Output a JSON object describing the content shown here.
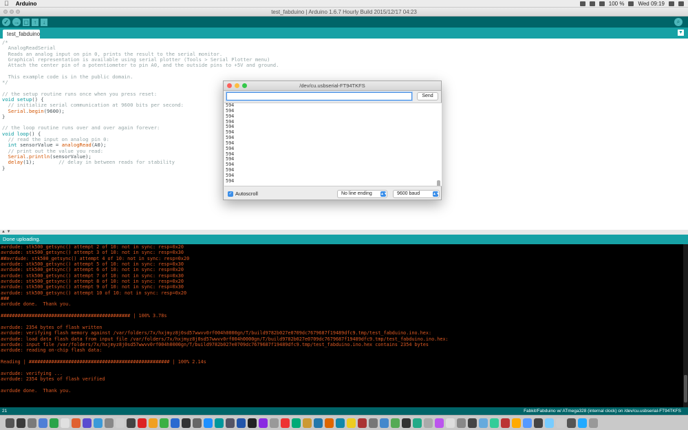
{
  "menubar": {
    "apple": "",
    "app_name": "Arduino",
    "battery": "100 %",
    "clock": "Wed 09:19"
  },
  "window": {
    "title": "test_fabduino | Arduino 1.6.7 Hourly Build 2015/12/17 04:23"
  },
  "toolbar": {
    "verify": "✓",
    "upload": "→",
    "new": "▢",
    "open": "↑",
    "save": "↓",
    "serial": "⌕"
  },
  "tab": {
    "name": "test_fabduino",
    "menu": "▼"
  },
  "code": [
    "/*",
    "  AnalogReadSerial",
    "  Reads an analog input on pin 0, prints the result to the serial monitor.",
    "  Graphical representation is available using serial plotter (Tools > Serial Plotter menu)",
    "  Attach the center pin of a potentiometer to pin A0, and the outside pins to +5V and ground.",
    "",
    "  This example code is in the public domain.",
    "*/",
    "",
    "// the setup routine runs once when you press reset:",
    "void setup() {",
    "  // initialize serial communication at 9600 bits per second:",
    "  Serial.begin(9600);",
    "}",
    "",
    "// the loop routine runs over and over again forever:",
    "void loop() {",
    "  // read the input on analog pin 0:",
    "  int sensorValue = analogRead(A0);",
    "  // print out the value you read:",
    "  Serial.println(sensorValue);",
    "  delay(1);        // delay in between reads for stability",
    "}"
  ],
  "divider_marker": "▲ ▼",
  "status": "Done uploading.",
  "console": [
    "avrdude: stk500_getsync() attempt 2 of 10: not in sync: resp=0x20",
    "avrdude: stk500_getsync() attempt 3 of 10: not in sync: resp=0x30",
    "##avrdude: stk500_getsync() attempt 4 of 10: not in sync: resp=0x20",
    "avrdude: stk500_getsync() attempt 5 of 10: not in sync: resp=0x30",
    "avrdude: stk500_getsync() attempt 6 of 10: not in sync: resp=0x20",
    "avrdude: stk500_getsync() attempt 7 of 10: not in sync: resp=0x30",
    "avrdude: stk500_getsync() attempt 8 of 10: not in sync: resp=0x20",
    "avrdude: stk500_getsync() attempt 9 of 10: not in sync: resp=0x30",
    "avrdude: stk500_getsync() attempt 10 of 10: not in sync: resp=0x20",
    "###",
    "avrdude done.  Thank you.",
    "",
    "############################################## | 100% 3.78s",
    "",
    "avrdude: 2354 bytes of flash written",
    "avrdude: verifying flash memory against /var/folders/7x/hxjmyz8j0sd57wwvv0rf004h0000gn/T/build9782b027e0709dc7679687f19489dfc9.tmp/test_fabduino.ino.hex:",
    "avrdude: load data flash data from input file /var/folders/7x/hxjmyz8j0sd57wwvv0rf004h0000gn/T/build9782b027e0709dc7679687f19489dfc9.tmp/test_fabduino.ino.hex:",
    "avrdude: input file /var/folders/7x/hxjmyz8j0sd57wwvv0rf004h0000gn/T/build9782b027e0709dc7679687f19489dfc9.tmp/test_fabduino.ino.hex contains 2354 bytes",
    "avrdude: reading on-chip flash data:",
    "",
    "Reading | ################################################## | 100% 2.14s",
    "",
    "avrdude: verifying ...",
    "avrdude: 2354 bytes of flash verified",
    "",
    "avrdude done.  Thank you."
  ],
  "footer": {
    "line_number": "21",
    "board_info": "Fabkit/Fabduino w/ ATmega328 (internal clock) on /dev/cu.usbserial-FT94TKFS"
  },
  "serial_monitor": {
    "title": "/dev/cu.usbserial-FT94TKFS",
    "input_value": "",
    "send_label": "Send",
    "output_lines": [
      "594",
      "594",
      "594",
      "594",
      "594",
      "594",
      "594",
      "594",
      "594",
      "594",
      "594",
      "594",
      "594",
      "594",
      "594"
    ],
    "autoscroll_label": "Autoscroll",
    "autoscroll_checked": true,
    "line_ending": "No line ending",
    "baud_rate": "9600 baud"
  },
  "colors": {
    "toolbar": "#006468",
    "tabbar": "#17a1a5",
    "console_text": "#e05a23"
  }
}
